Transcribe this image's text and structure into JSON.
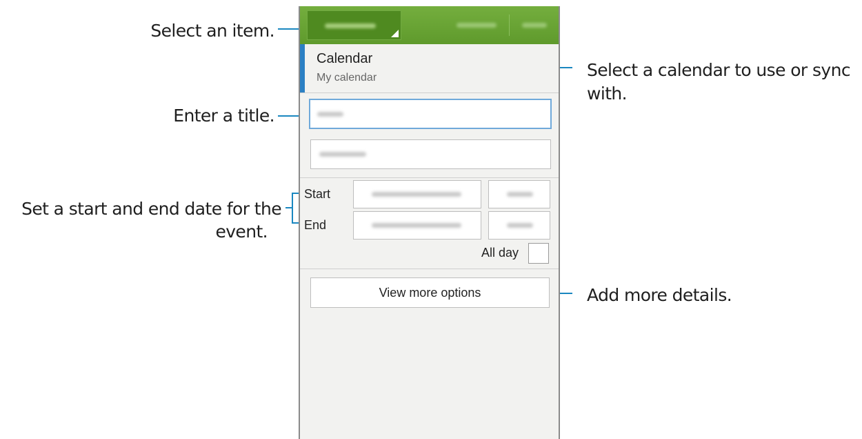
{
  "callouts": {
    "select_item": "Select an item.",
    "select_calendar_line1": "Select a calendar to use or sync",
    "select_calendar_line2": "with.",
    "enter_title": "Enter a title.",
    "set_dates_line1": "Set a start and end date for the",
    "set_dates_line2": "event.",
    "add_details": "Add more details."
  },
  "calendar": {
    "title": "Calendar",
    "subtitle": "My calendar"
  },
  "datetime": {
    "start_label": "Start",
    "end_label": "End",
    "all_day_label": "All day"
  },
  "more_options": {
    "label": "View more options"
  },
  "colors": {
    "appbar": "#6aa535",
    "accent": "#2b80c4",
    "leader_line": "#1a87c0"
  }
}
